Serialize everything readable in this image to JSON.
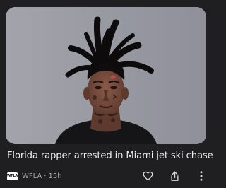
{
  "story": {
    "headline": "Florida rapper arrested in Miami jet ski chase",
    "source": "WFLA",
    "source_logo_text": "WFLA",
    "separator": "·",
    "age": "15h"
  },
  "actions": {
    "like_icon": "heart-outline-icon",
    "share_icon": "share-icon",
    "more_icon": "more-vertical-icon"
  },
  "colors": {
    "background": "#1f1f21",
    "headline_text": "#ececee",
    "meta_text": "#a9a9ad",
    "icon": "#d8d8da"
  }
}
